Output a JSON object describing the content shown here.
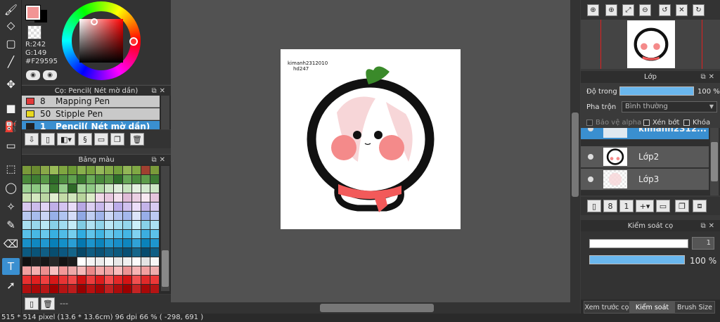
{
  "color": {
    "foreground_hex": "#F29595",
    "r_label": "R:242",
    "g_label": "G:149",
    "hex_label": "#F29595"
  },
  "brush_panel": {
    "title": "Cọ: Pencil( Nét mờ dần)",
    "items": [
      {
        "num": "8",
        "name": "Mapping Pen",
        "color": "#e23b3b"
      },
      {
        "num": "50",
        "name": "Stipple Pen",
        "color": "#e8d81e"
      },
      {
        "num": "1",
        "name": "Pencil( Nét mờ dần)",
        "color": "#222222"
      }
    ]
  },
  "palette_panel": {
    "title": "Bảng màu",
    "footer_text": "---"
  },
  "canvas": {
    "doc_text_line1": "kimanh2312010",
    "doc_text_line2": "hd247"
  },
  "layer_panel": {
    "title": "Lớp",
    "opacity_label": "Độ trong",
    "opacity_value": "100 %",
    "opacity_fraction": 1.0,
    "blend_label": "Pha trộn",
    "blend_value": "Bình thường",
    "protect_alpha": "Bảo vệ alpha",
    "clipping": "Xén bớt",
    "lock": "Khóa",
    "layers": [
      {
        "name": "kimanh2312..."
      },
      {
        "name": "Lớp2"
      },
      {
        "name": "Lớp3"
      }
    ]
  },
  "brush_control": {
    "title": "Kiểm soát cọ",
    "size_value": "1",
    "opacity_value": "100 %",
    "opacity_fraction": 1.0
  },
  "tabs": [
    {
      "label": "Xem trước cọ"
    },
    {
      "label": "Kiểm soát cọ"
    },
    {
      "label": "Brush Size"
    }
  ],
  "status_bar": "515 * 514 pixel   (13.6 * 13.6cm)   96 dpi   66 %   ( -298, 691 )"
}
